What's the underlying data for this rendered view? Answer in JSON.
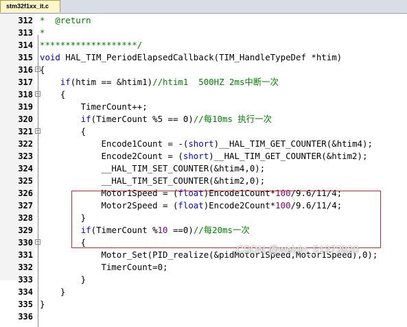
{
  "tab": {
    "label": "stm32f1xx_it.c"
  },
  "lines": [
    {
      "num": "312",
      "segs": [
        {
          "t": "*  ",
          "c": "cm"
        },
        {
          "t": "@return",
          "c": "cm"
        }
      ]
    },
    {
      "num": "313",
      "segs": [
        {
          "t": "*",
          "c": "cm"
        }
      ]
    },
    {
      "num": "314",
      "segs": [
        {
          "t": "*******************/",
          "c": "cm"
        }
      ]
    },
    {
      "num": "315",
      "segs": [
        {
          "t": "void",
          "c": "kw"
        },
        {
          "t": " HAL_TIM_PeriodElapsedCallback(TIM_HandleTypeDef *htim)",
          "c": "pr"
        }
      ]
    },
    {
      "num": "316",
      "segs": [
        {
          "t": "{",
          "c": "pr"
        }
      ]
    },
    {
      "num": "317",
      "segs": [
        {
          "t": "    ",
          "c": "pr"
        },
        {
          "t": "if",
          "c": "kw"
        },
        {
          "t": "(htim == &htim1)",
          "c": "pr"
        },
        {
          "t": "//htim1  500HZ 2ms中断一次",
          "c": "cm"
        }
      ]
    },
    {
      "num": "318",
      "segs": [
        {
          "t": "    {",
          "c": "pr"
        }
      ]
    },
    {
      "num": "319",
      "segs": [
        {
          "t": "        TimerCount++;",
          "c": "pr"
        }
      ]
    },
    {
      "num": "320",
      "segs": [
        {
          "t": "        ",
          "c": "pr"
        },
        {
          "t": "if",
          "c": "kw"
        },
        {
          "t": "(TimerCount %5 == 0)",
          "c": "pr"
        },
        {
          "t": "//每10ms 执行一次",
          "c": "cm"
        }
      ]
    },
    {
      "num": "321",
      "segs": [
        {
          "t": "        {",
          "c": "pr"
        }
      ]
    },
    {
      "num": "322",
      "segs": [
        {
          "t": "            Encode1Count = -(",
          "c": "pr"
        },
        {
          "t": "short",
          "c": "kw"
        },
        {
          "t": ")__HAL_TIM_GET_COUNTER(&htim4);",
          "c": "pr"
        }
      ]
    },
    {
      "num": "323",
      "segs": [
        {
          "t": "            Encode2Count = (",
          "c": "pr"
        },
        {
          "t": "short",
          "c": "kw"
        },
        {
          "t": ")__HAL_TIM_GET_COUNTER(&htim2);",
          "c": "pr"
        }
      ]
    },
    {
      "num": "324",
      "segs": [
        {
          "t": "            __HAL_TIM_SET_COUNTER(&htim4,0);",
          "c": "pr"
        }
      ]
    },
    {
      "num": "325",
      "segs": [
        {
          "t": "            __HAL_TIM_SET_COUNTER(&htim2,0);",
          "c": "pr"
        }
      ]
    },
    {
      "num": "326",
      "segs": [
        {
          "t": "            Motor1Speed = (",
          "c": "pr"
        },
        {
          "t": "float",
          "c": "kw"
        },
        {
          "t": ")Encode1Count*",
          "c": "pr"
        },
        {
          "t": "100",
          "c": "nm"
        },
        {
          "t": "/9.6/11/4;",
          "c": "pr"
        }
      ]
    },
    {
      "num": "327",
      "segs": [
        {
          "t": "            Motor2Speed = (",
          "c": "pr"
        },
        {
          "t": "float",
          "c": "kw"
        },
        {
          "t": ")Encode2Count*",
          "c": "pr"
        },
        {
          "t": "100",
          "c": "nm"
        },
        {
          "t": "/9.6/11/4;",
          "c": "pr"
        }
      ]
    },
    {
      "num": "328",
      "segs": [
        {
          "t": "        }",
          "c": "pr"
        }
      ]
    },
    {
      "num": "329",
      "segs": [
        {
          "t": "        ",
          "c": "pr"
        },
        {
          "t": "if",
          "c": "kw"
        },
        {
          "t": "(TimerCount %",
          "c": "pr"
        },
        {
          "t": "10",
          "c": "nm"
        },
        {
          "t": " ==0)",
          "c": "pr"
        },
        {
          "t": "//每20ms一次",
          "c": "cm"
        }
      ]
    },
    {
      "num": "330",
      "segs": [
        {
          "t": "        {",
          "c": "pr"
        }
      ]
    },
    {
      "num": "331",
      "segs": [
        {
          "t": "            Motor_Set(PID_realize(&pidMotor1Speed,Motor1Speed),0);",
          "c": "pr"
        }
      ]
    },
    {
      "num": "332",
      "segs": [
        {
          "t": "            TimerCount=0;",
          "c": "pr"
        }
      ]
    },
    {
      "num": "333",
      "segs": [
        {
          "t": "        }",
          "c": "pr"
        }
      ]
    },
    {
      "num": "334",
      "segs": [
        {
          "t": "    }",
          "c": "pr"
        }
      ]
    },
    {
      "num": "335",
      "segs": [
        {
          "t": "}",
          "c": "pr"
        }
      ]
    },
    {
      "num": "336",
      "segs": []
    }
  ],
  "fold_markers_at": [
    "316",
    "318",
    "321",
    "330"
  ],
  "watermark": "CSDN @weixin_51373820",
  "colors": {
    "keyword": "#0000ff",
    "comment": "#008000",
    "number": "#800080",
    "highlight_box": "#d8262e"
  }
}
